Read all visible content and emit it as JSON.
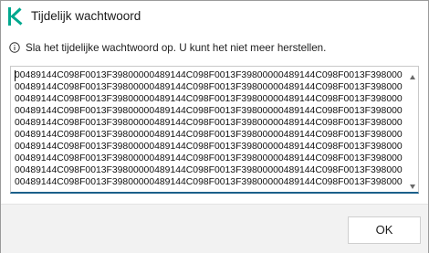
{
  "window": {
    "title": "Tijdelijk wachtwoord"
  },
  "info": {
    "icon": "info-circle-icon",
    "text": "Sla het tijdelijke wachtwoord op. U kunt het niet meer herstellen."
  },
  "password": {
    "value": "00489144C098F0013F39800000489144C098F0013F39800000489144C098F0013F39800000489144C098F0013F39800000489144C098F0013F39800000489144C098F0013F39800000489144C098F0013F39800000489144C098F0013F39800000489144C098F0013F39800000489144C098F0013F39800000489144C098F0013F39800000489144C098F0013F39800000489144C098F0013F39800000489144C098F0013F39800000489144C098F0013F39800000489144C098F0013F39800000489144C098F0013F39800000489144C098F0013F39800000489144C098F0013F39800000489144C098F0013F39800000489144C098F0013F39800000489144C098F0013F39800000489144C098F0013F39800000489144C098F0013F39800000489144C098F0013F39800000489144C098F0013F39800000489144C098F0013F39800000489144C098F0013F39800000489144C098F0013F39800000489144C098F0013F398000"
  },
  "footer": {
    "ok_label": "OK"
  },
  "colors": {
    "brand": "#00a88e",
    "focus_underline": "#1b5f8a",
    "footer_bg": "#f2f2f2"
  }
}
